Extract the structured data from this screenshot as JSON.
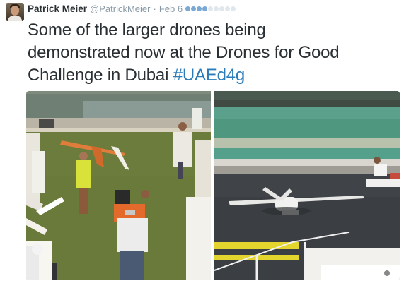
{
  "tweet": {
    "author_name": "Patrick Meier",
    "author_handle": "@PatrickMeier",
    "separator": "·",
    "date": "Feb 6",
    "text_line1": "Some of the larger drones being",
    "text_line2": "demonstrated now at the Drones for Good",
    "text_line3_prefix": "Challenge in Dubai ",
    "hashtag": "#UAEd4g",
    "loader_dots_active": 4,
    "loader_dots_total": 9,
    "colors": {
      "name": "#292f33",
      "meta": "#8899a6",
      "hashtag": "#2b7bb9",
      "loader_active": "#7aa9d6",
      "loader_inactive": "#e1e8ed"
    }
  },
  "media": {
    "photos": [
      {
        "description_icon": "drone-demo-lawn-photo"
      },
      {
        "description_icon": "drone-on-tarmac-photo"
      }
    ]
  }
}
